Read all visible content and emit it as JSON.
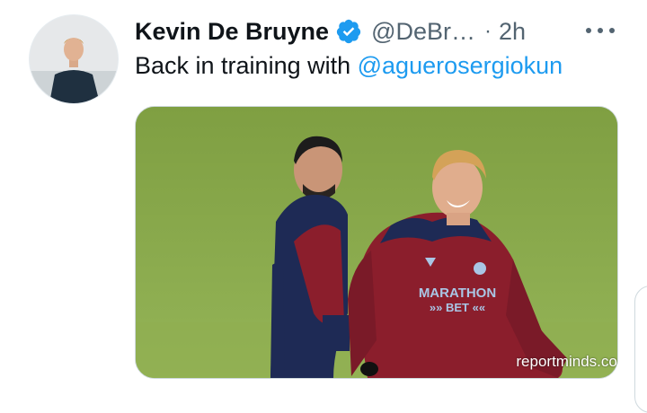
{
  "tweet": {
    "author_name": "Kevin De Bruyne",
    "handle": "@DeBr…",
    "separator": "·",
    "time": "2h",
    "text_prefix": "Back in training with ",
    "mention": "@aguerosergiokun",
    "verified_icon": "verified-badge-icon",
    "more_icon": "more-options-icon"
  },
  "media": {
    "shirt_text_line1": "MARATHON",
    "shirt_text_line2": "»» BET ««",
    "watermark": "reportminds.com"
  },
  "colors": {
    "accent": "#1d9bf0",
    "secondary_text": "#536471",
    "primary_text": "#0f1419",
    "grass": "#86a848",
    "kit_maroon": "#8b1e2c",
    "kit_navy": "#1e2a55"
  }
}
